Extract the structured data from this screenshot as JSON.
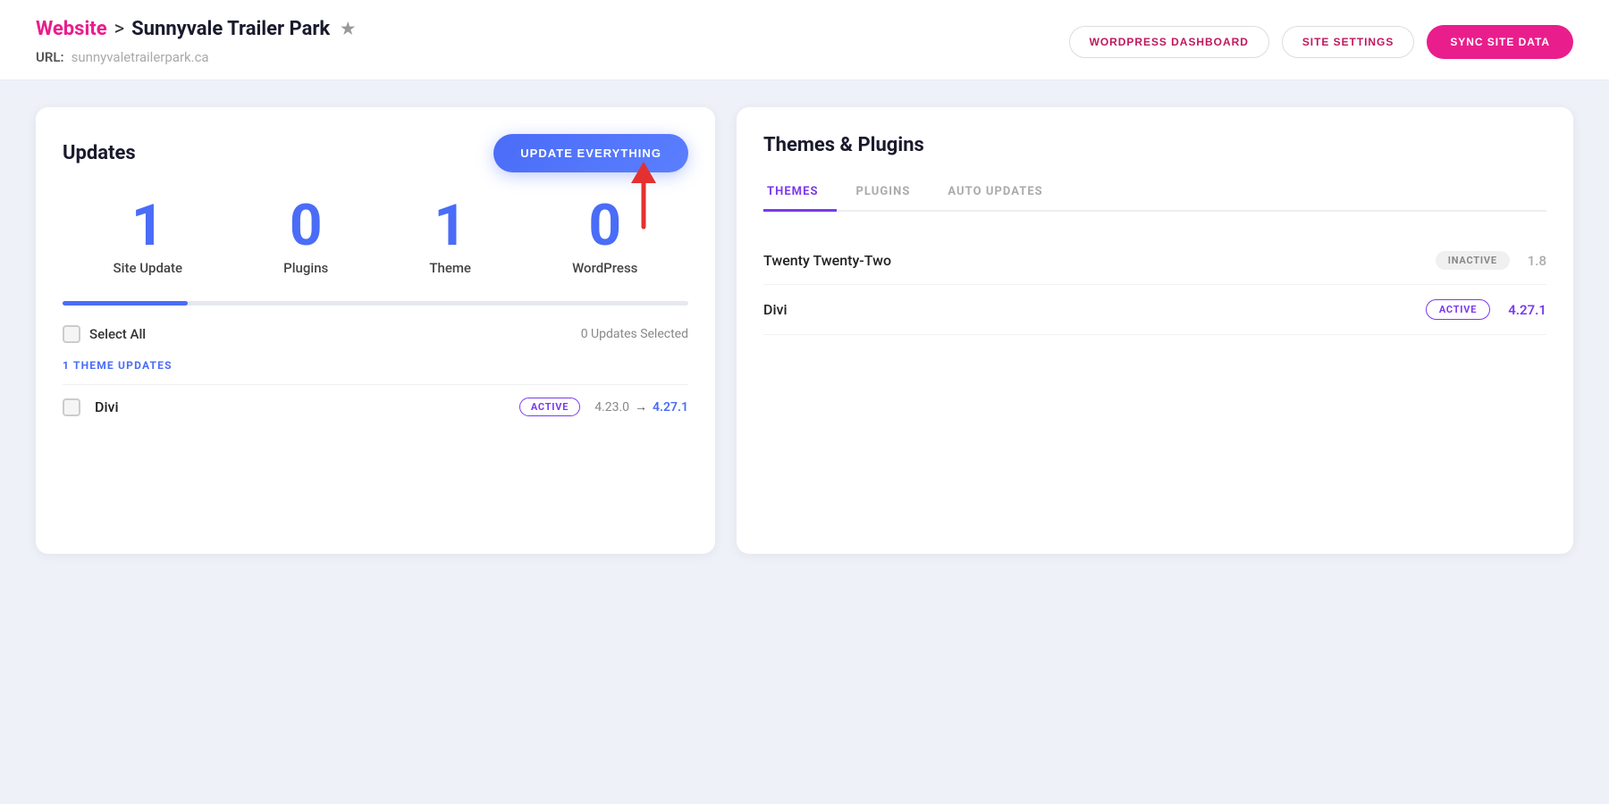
{
  "header": {
    "breadcrumb_website": "Website",
    "breadcrumb_separator": ">",
    "breadcrumb_title": "Sunnyvale Trailer Park",
    "breadcrumb_star": "★",
    "url_label": "URL:",
    "url_value": "sunnyvaletrailerpark.ca",
    "btn_wordpress_dashboard": "WORDPRESS DASHBOARD",
    "btn_site_settings": "SITE SETTINGS",
    "btn_sync_site_data": "SYNC SITE DATA"
  },
  "updates_panel": {
    "title": "Updates",
    "btn_update_everything": "UPDATE EVERYTHING",
    "stats": [
      {
        "number": "1",
        "label": "Site Update"
      },
      {
        "number": "0",
        "label": "Plugins"
      },
      {
        "number": "1",
        "label": "Theme"
      },
      {
        "number": "0",
        "label": "WordPress"
      }
    ],
    "progress_percent": 20,
    "select_all_label": "Select All",
    "updates_selected": "0 Updates Selected",
    "section_label": "1 THEME UPDATES",
    "theme_update_item": {
      "name": "Divi",
      "badge": "ACTIVE",
      "version_old": "4.23.0",
      "version_arrow": "→",
      "version_new": "4.27.1"
    }
  },
  "themes_plugins_panel": {
    "title": "Themes & Plugins",
    "tabs": [
      {
        "label": "THEMES",
        "active": true
      },
      {
        "label": "PLUGINS",
        "active": false
      },
      {
        "label": "AUTO UPDATES",
        "active": false
      }
    ],
    "themes": [
      {
        "name": "Twenty Twenty-Two",
        "badge_type": "inactive",
        "badge_label": "INACTIVE",
        "version": "1.8"
      },
      {
        "name": "Divi",
        "badge_type": "active",
        "badge_label": "ACTIVE",
        "version": "4.27.1"
      }
    ]
  }
}
